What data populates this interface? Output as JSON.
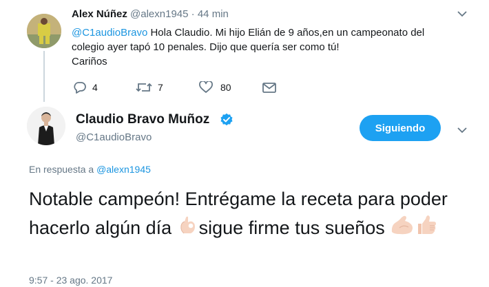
{
  "reply_tweet": {
    "display_name": "Alex Núñez",
    "handle": "@alexn1945",
    "separator": "·",
    "time": "44 min",
    "mention": "@C1audioBravo",
    "text_after_mention": " Hola Claudio. Mi hijo Elián de 9 años,en un campeonato del colegio ayer tapó 10 penales. Dijo que quería ser como tú!",
    "text_line_final": "Cariños",
    "actions": {
      "reply_count": "4",
      "retweet_count": "7",
      "like_count": "80"
    }
  },
  "main_tweet": {
    "display_name": "Claudio Bravo Muñoz",
    "handle": "@C1audioBravo",
    "follow_button_label": "Siguiendo",
    "reply_to_prefix": "En respuesta a",
    "reply_to_handle": "@alexn1945",
    "text_part1": "Notable campeón! Entrégame la receta para poder hacerlo algún día ",
    "text_part2": "sigue firme tus sueños ",
    "timestamp": "9:57 - 23 ago. 2017"
  },
  "icons": {
    "reply": "reply-icon",
    "retweet": "retweet-icon",
    "like": "heart-icon",
    "dm": "envelope-icon",
    "verified": "verified-badge-icon",
    "more": "chevron-down-icon",
    "ok_emoji": "ok-hand-emoji",
    "muscle_emoji": "flexed-biceps-emoji",
    "thumbs_emoji": "thumbs-up-emoji"
  },
  "colors": {
    "link": "#1b95e0",
    "muted": "#657786",
    "follow_button_bg": "#1da1f2",
    "text": "#14171a"
  }
}
